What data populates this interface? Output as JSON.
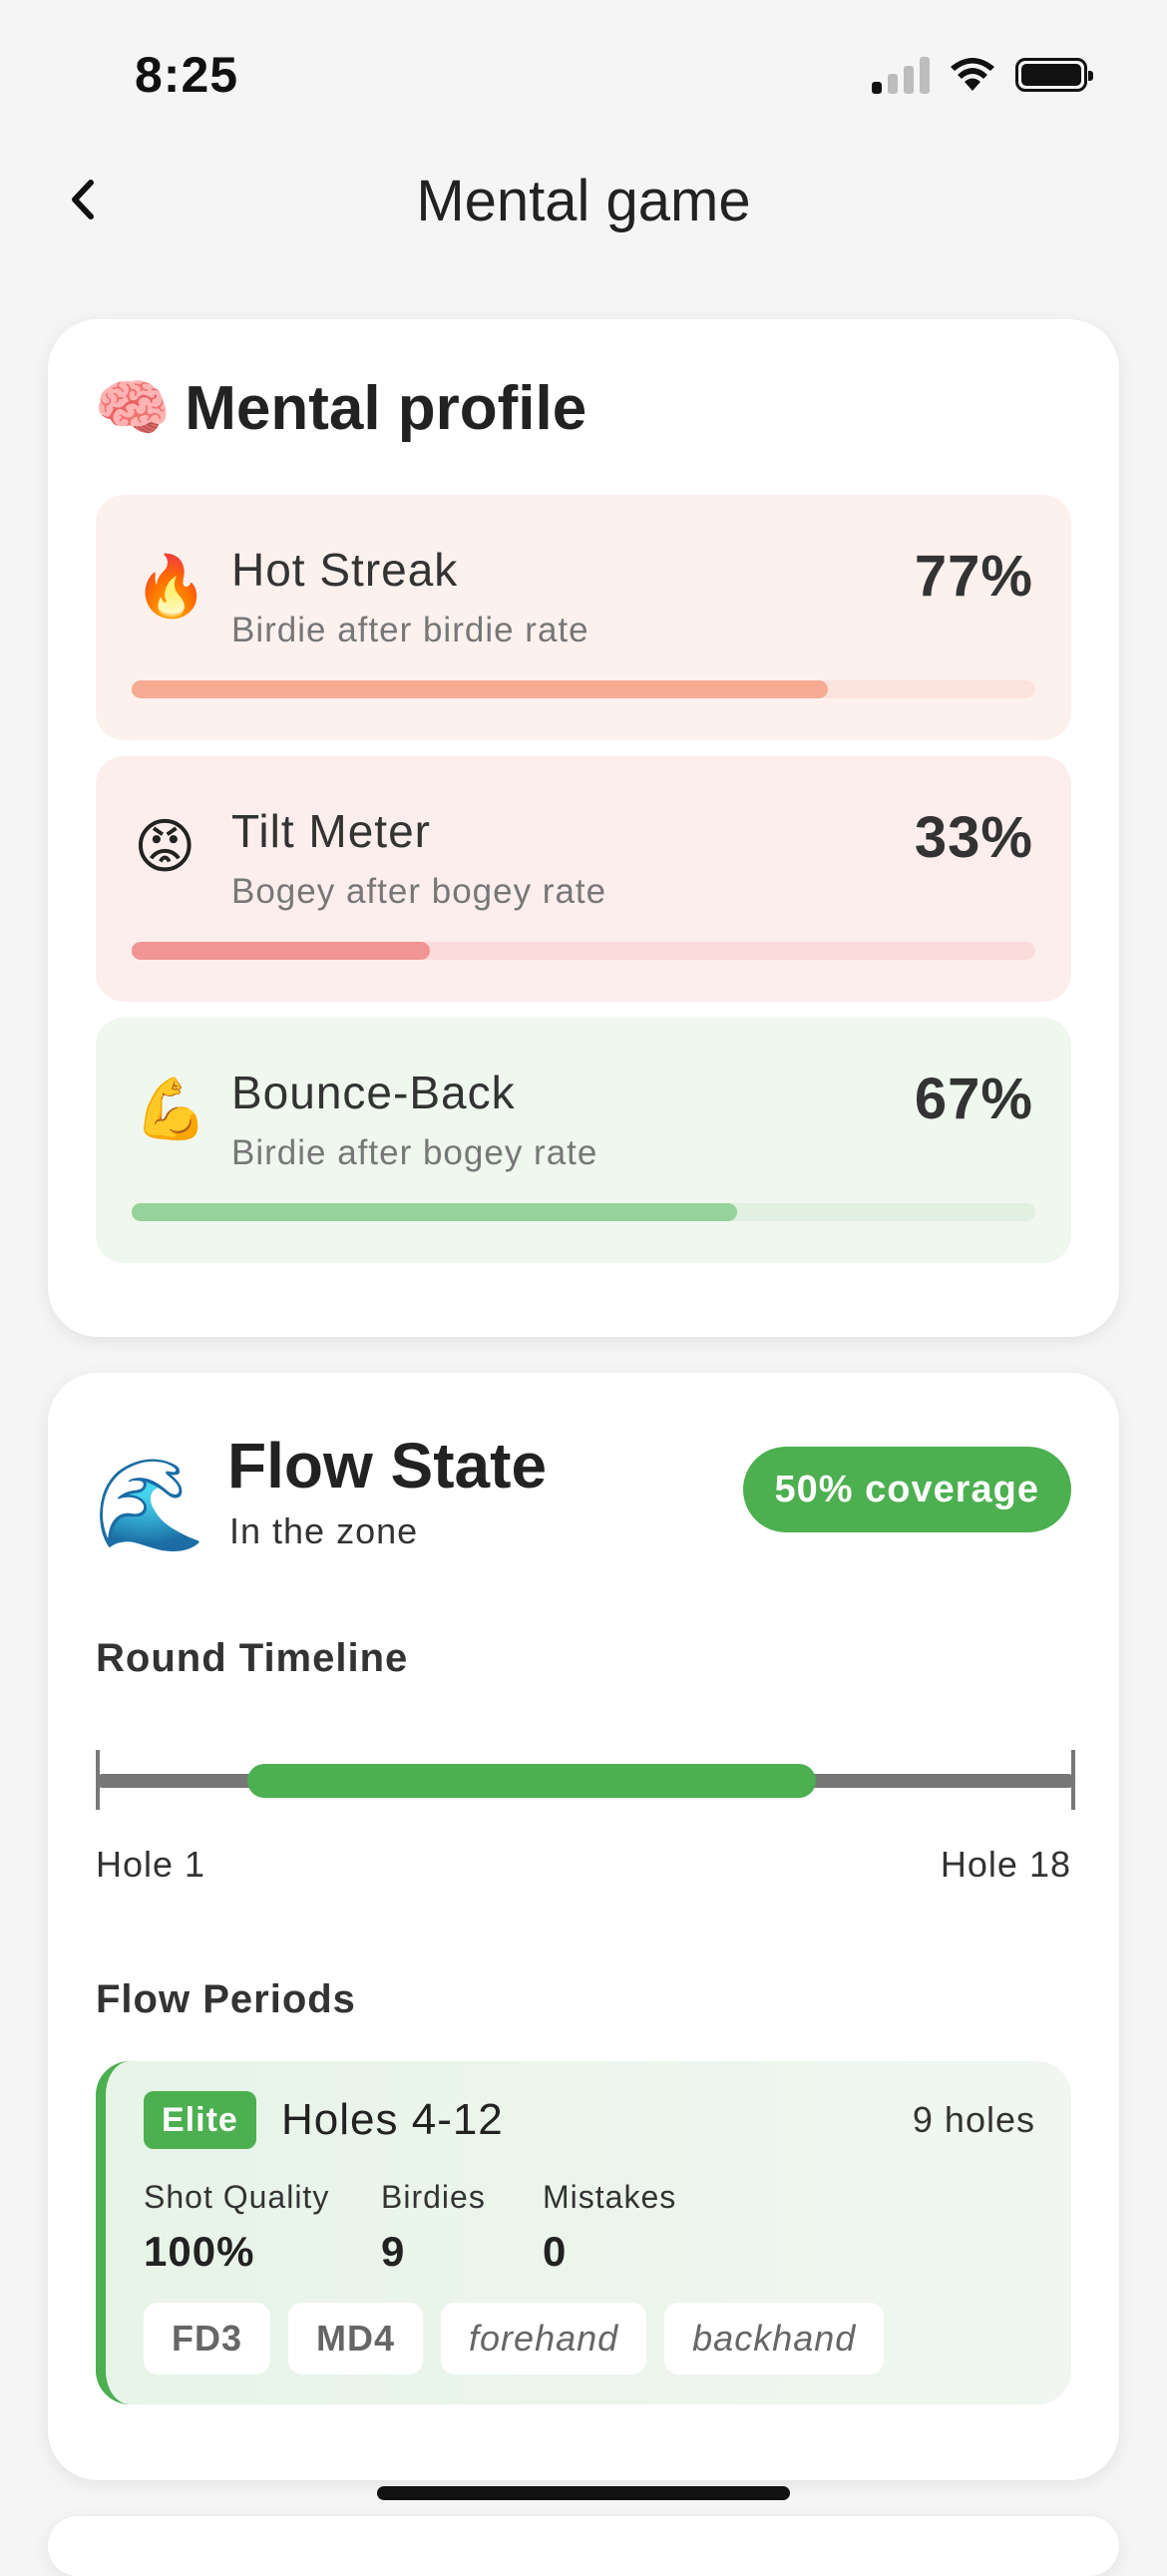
{
  "status": {
    "time": "8:25"
  },
  "nav": {
    "title": "Mental game"
  },
  "profile": {
    "emoji": "🧠",
    "title": "Mental profile",
    "metrics": [
      {
        "icon": "🔥",
        "icon_name": "fire-icon",
        "title": "Hot Streak",
        "subtitle": "Birdie after birdie rate",
        "value": "77%",
        "fraction": 0.77,
        "bg": "#fdf1ee",
        "track": "#fbe4dd",
        "fill": "#f6ab92"
      },
      {
        "icon": "😡",
        "icon_name": "angry-face-icon",
        "title": "Tilt Meter",
        "subtitle": "Bogey after bogey rate",
        "value": "33%",
        "fraction": 0.33,
        "bg": "#fdeeee",
        "track": "#fadcdc",
        "fill": "#f19494"
      },
      {
        "icon": "💪",
        "icon_name": "flexed-biceps-icon",
        "title": "Bounce-Back",
        "subtitle": "Birdie after bogey rate",
        "value": "67%",
        "fraction": 0.67,
        "bg": "#eff7ef",
        "track": "#e1f0e1",
        "fill": "#95d39a"
      }
    ]
  },
  "flow": {
    "emoji": "🌊",
    "title": "Flow State",
    "subtitle": "In the zone",
    "coverage": "50% coverage",
    "timeline_label": "Round Timeline",
    "timeline": {
      "start": 0.155,
      "end": 0.735
    },
    "hole_start": "Hole 1",
    "hole_end": "Hole 18",
    "periods_label": "Flow Periods",
    "period": {
      "badge": "Elite",
      "title": "Holes 4-12",
      "count": "9 holes",
      "stats": [
        {
          "label": "Shot Quality",
          "value": "100%"
        },
        {
          "label": "Birdies",
          "value": "9"
        },
        {
          "label": "Mistakes",
          "value": "0"
        }
      ],
      "discs": [
        "FD3",
        "MD4"
      ],
      "throws": [
        "forehand",
        "backhand"
      ]
    }
  },
  "colors": {
    "accent": "#4caf50"
  }
}
